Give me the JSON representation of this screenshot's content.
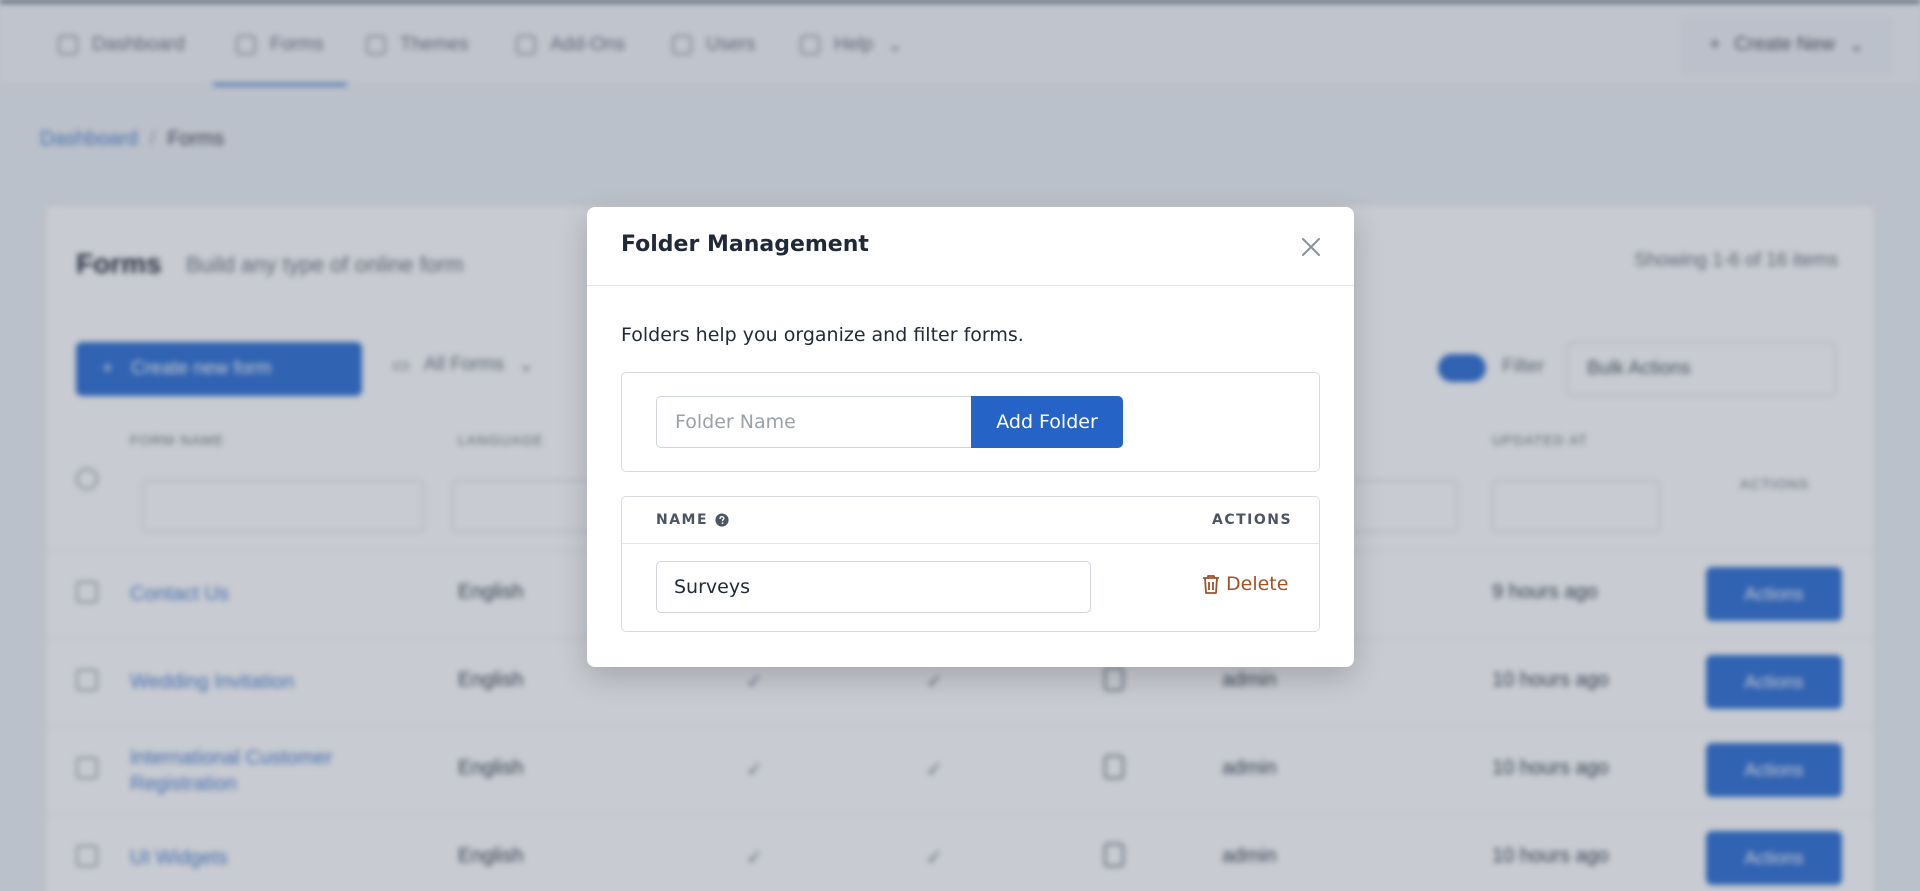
{
  "nav": {
    "items": [
      {
        "label": "Dashboard",
        "icon": "dashboard-icon"
      },
      {
        "label": "Forms",
        "icon": "forms-icon"
      },
      {
        "label": "Themes",
        "icon": "themes-icon"
      },
      {
        "label": "Add-Ons",
        "icon": "addons-icon"
      },
      {
        "label": "Users",
        "icon": "users-icon"
      },
      {
        "label": "Help",
        "icon": "help-icon"
      }
    ],
    "create_new": "Create New"
  },
  "breadcrumb": {
    "home": "Dashboard",
    "separator": "/",
    "current": "Forms"
  },
  "forms_page": {
    "title": "Forms",
    "subtitle": "Build any type of online form",
    "showing": "Showing 1-6 of 16 items",
    "create_button": "Create new form",
    "folder_filter": "All Forms",
    "filter_label": "Filter",
    "bulk_actions": "Bulk Actions",
    "columns": {
      "form_name": "FORM NAME",
      "language": "LANGUAGE",
      "updated": "UPDATED AT",
      "actions": "ACTIONS"
    },
    "rows": [
      {
        "name": "Contact Us",
        "language": "English",
        "owner": "",
        "updated": "9 hours ago",
        "action": "Actions"
      },
      {
        "name": "Wedding Invitation",
        "language": "English",
        "owner": "admin",
        "updated": "10 hours ago",
        "action": "Actions"
      },
      {
        "name": "International Customer Registration",
        "language": "English",
        "owner": "admin",
        "updated": "10 hours ago",
        "action": "Actions"
      },
      {
        "name": "UI Widgets",
        "language": "English",
        "owner": "admin",
        "updated": "10 hours ago",
        "action": "Actions"
      }
    ],
    "tick": "✓"
  },
  "modal": {
    "title": "Folder Management",
    "description": "Folders help you organize and filter forms.",
    "folder_input_placeholder": "Folder Name",
    "add_button": "Add Folder",
    "table": {
      "name_header": "NAME",
      "actions_header": "ACTIONS",
      "folders": [
        {
          "name": "Surveys",
          "delete_label": "Delete"
        }
      ]
    }
  },
  "colors": {
    "primary": "#2563c7",
    "delete": "#a0522d",
    "overlay": "rgba(58,70,88,0.28)"
  }
}
